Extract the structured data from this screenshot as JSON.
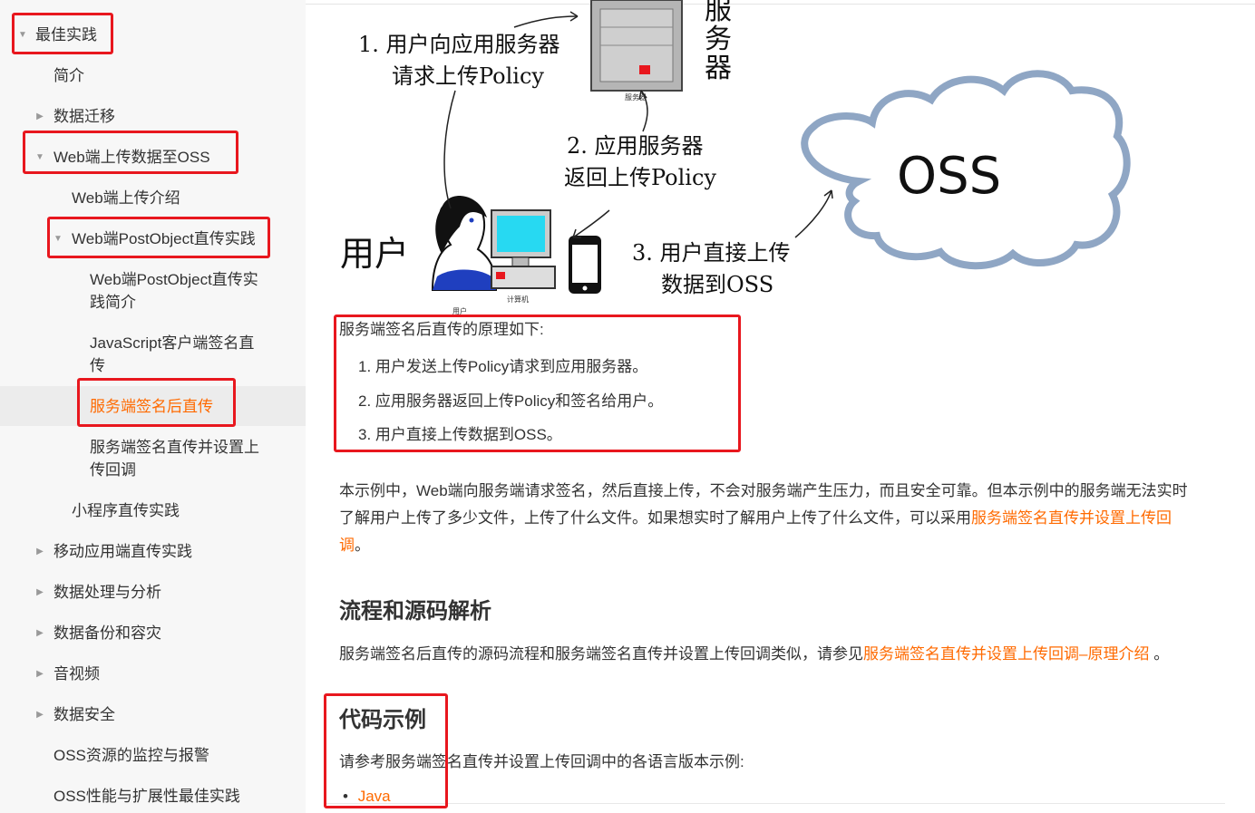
{
  "sidebar": {
    "items": [
      {
        "label": "最佳实践",
        "caret": "▼"
      },
      {
        "label": "简介"
      },
      {
        "label": "数据迁移",
        "caret": "▶"
      },
      {
        "label": "Web端上传数据至OSS",
        "caret": "▼"
      },
      {
        "label": "Web端上传介绍"
      },
      {
        "label": "Web端PostObject直传实践",
        "caret": "▼"
      },
      {
        "label_lines": [
          "Web端PostObject直传实",
          "践简介"
        ]
      },
      {
        "label_lines": [
          "JavaScript客户端签名直",
          "传"
        ]
      },
      {
        "label": "服务端签名后直传",
        "active": true
      },
      {
        "label_lines": [
          "服务端签名直传并设置上",
          "传回调"
        ]
      },
      {
        "label": "小程序直传实践"
      },
      {
        "label": "移动应用端直传实践",
        "caret": "▶"
      },
      {
        "label": "数据处理与分析",
        "caret": "▶"
      },
      {
        "label": "数据备份和容灾",
        "caret": "▶"
      },
      {
        "label": "音视频",
        "caret": "▶"
      },
      {
        "label": "数据安全",
        "caret": "▶"
      },
      {
        "label": "OSS资源的监控与报警"
      },
      {
        "label": "OSS性能与扩展性最佳实践"
      }
    ]
  },
  "diagram": {
    "step1_lines": [
      "1. 用户向应用服务器",
      "请求上传Policy"
    ],
    "step2_lines": [
      "2. 应用服务器",
      "返回上传Policy"
    ],
    "step3_lines": [
      "3. 用户直接上传",
      "数据到OSS"
    ],
    "server_label_chars": [
      "服",
      "务",
      "器"
    ],
    "server_caption": "服务器",
    "user_label": "用户",
    "user_caption": "用户",
    "computer_caption": "计算机",
    "oss_label": "OSS"
  },
  "content": {
    "principle_intro": "服务端签名后直传的原理如下:",
    "principle_steps": [
      "1. 用户发送上传Policy请求到应用服务器。",
      "2. 应用服务器返回上传Policy和签名给用户。",
      "3. 用户直接上传数据到OSS。"
    ],
    "example_para_line1": "本示例中，Web端向服务端请求签名，然后直接上传，不会对服务端产生压力，而且安全可靠。但本示例中的服务端无法实时",
    "example_para_line2_text": "了解用户上传了多少文件，上传了什么文件。如果想实时了解用户上传了什么文件，可以采用",
    "example_para_line2_link": "服务端签名直传并设置上传回",
    "example_para_line3_link": "调",
    "example_para_line3_text": "。",
    "section1_title": "流程和源码解析",
    "section1_para_text": "服务端签名后直传的源码流程和服务端签名直传并设置上传回调类似，请参见",
    "section1_para_link": "服务端签名直传并设置上传回调–原理介绍",
    "section1_para_end": " 。",
    "section2_title": "代码示例",
    "section2_para": "请参考服务端签名直传并设置上传回调中的各语言版本示例:",
    "language_links": [
      "Java"
    ]
  },
  "colors": {
    "accent": "#ff6a00",
    "highlight_box": "#e8171e",
    "sidebar_bg": "#f7f7f7",
    "cloud_stroke": "#8fa6c4"
  }
}
